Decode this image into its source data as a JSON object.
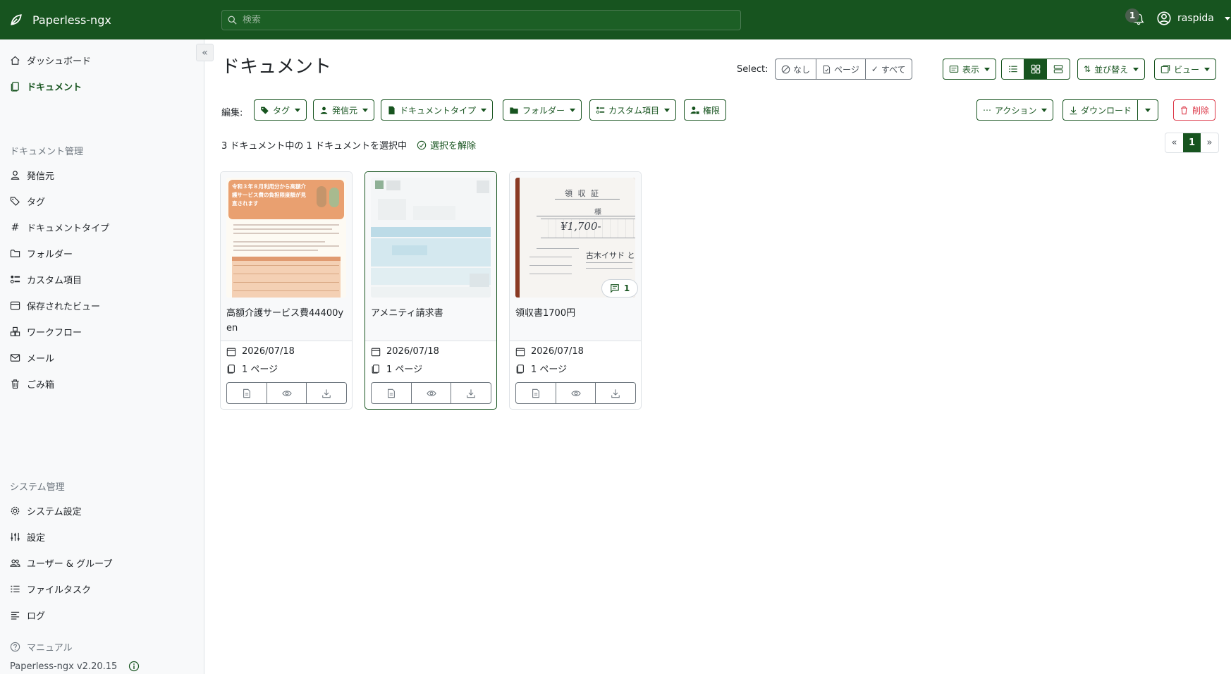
{
  "app": {
    "name": "Paperless-ngx",
    "version": "Paperless-ngx v2.20.15"
  },
  "search": {
    "placeholder": "検索"
  },
  "notifications": {
    "count": "1"
  },
  "user": {
    "name": "raspida"
  },
  "sidebar": {
    "top_items": [
      {
        "label": "ダッシュボード",
        "icon": "house-icon"
      },
      {
        "label": "ドキュメント",
        "icon": "file-icon",
        "active": true
      }
    ],
    "manage_title": "ドキュメント管理",
    "manage_items": [
      {
        "label": "発信元",
        "icon": "person-icon"
      },
      {
        "label": "タグ",
        "icon": "tags-icon"
      },
      {
        "label": "ドキュメントタイプ",
        "icon": "hash-icon"
      },
      {
        "label": "フォルダー",
        "icon": "folder-icon"
      },
      {
        "label": "カスタム項目",
        "icon": "ui-radios-icon"
      },
      {
        "label": "保存されたビュー",
        "icon": "window-icon"
      },
      {
        "label": "ワークフロー",
        "icon": "boxes-icon"
      },
      {
        "label": "メール",
        "icon": "envelope-icon"
      },
      {
        "label": "ごみ箱",
        "icon": "trash-icon"
      }
    ],
    "admin_title": "システム管理",
    "admin_items": [
      {
        "label": "システム設定",
        "icon": "gear-icon"
      },
      {
        "label": "設定",
        "icon": "sliders-icon"
      },
      {
        "label": "ユーザー & グループ",
        "icon": "people-icon"
      },
      {
        "label": "ファイルタスク",
        "icon": "list-task-icon"
      },
      {
        "label": "ログ",
        "icon": "text-left-icon"
      }
    ],
    "manual_label": "マニュアル"
  },
  "main": {
    "title": "ドキュメント",
    "select_label": "Select:",
    "select_buttons": [
      "なし",
      "ページ",
      "すべて"
    ],
    "display_label": "表示",
    "sort_label": "並び替え",
    "view_label": "ビュー",
    "edit_label": "編集:",
    "edit_buttons": [
      "タグ",
      "発信元",
      "ドキュメントタイプ",
      "フォルダー",
      "カスタム項目",
      "権限"
    ],
    "actions_label": "アクション",
    "download_label": "ダウンロード",
    "delete_label": "削除",
    "selection_info": "3 ドキュメント中の 1 ドキュメントを選択中",
    "clear_selection": "選択を解除",
    "pagination": {
      "prev": "«",
      "current": "1",
      "next": "»"
    }
  },
  "documents": [
    {
      "title": "高額介護サービス費44400yen",
      "date": "2026/07/18",
      "pages": "1 ページ",
      "selected": false
    },
    {
      "title": "アメニティ請求書",
      "date": "2026/07/18",
      "pages": "1 ページ",
      "selected": true
    },
    {
      "title": "領収書1700円",
      "date": "2026/07/18",
      "pages": "1 ページ",
      "selected": false,
      "notes": "1"
    }
  ],
  "thumb_text": {
    "care_banner": "令和３年８月利用分から高額介護サービス費の負担限度額が見直されます",
    "receipt_heading": "領 収 証",
    "receipt_honorific": "様",
    "receipt_amount": "¥1,700-",
    "receipt_issuer": "古木イサド とと"
  },
  "colors": {
    "brand": "#17541f",
    "danger": "#dc3545"
  }
}
